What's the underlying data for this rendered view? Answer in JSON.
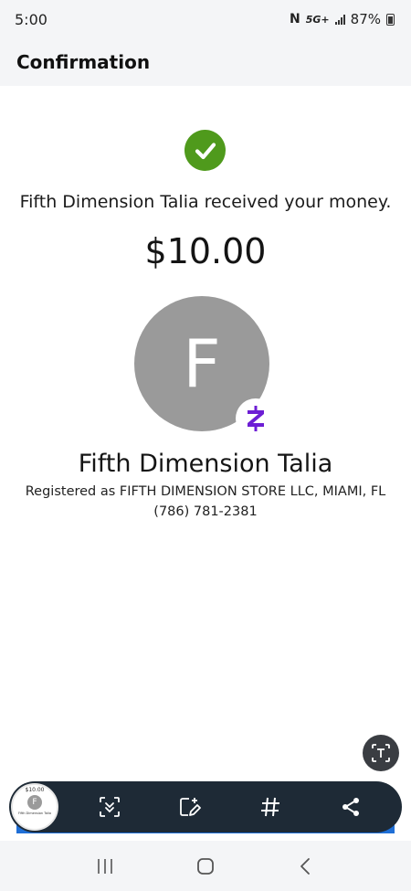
{
  "status_bar": {
    "time": "5:00",
    "nfc": "N",
    "network": "5G+",
    "battery": "87%"
  },
  "header": {
    "title": "Confirmation"
  },
  "confirmation": {
    "message": "Fifth Dimension Talia received your money.",
    "amount": "$10.00"
  },
  "recipient": {
    "initial": "F",
    "name": "Fifth Dimension Talia",
    "registered": "Registered as FIFTH DIMENSION STORE LLC, MIAMI, FL",
    "phone": "(786) 781-2381"
  },
  "screenshot_toolbar": {
    "thumbnail": {
      "amount": "$10.00",
      "initial": "F",
      "name": "Fifth Dimension Talia"
    },
    "tools": [
      "scroll-capture-icon",
      "draw-icon",
      "hashtag-icon",
      "share-icon"
    ]
  },
  "colors": {
    "success": "#4f9a1c",
    "zelle": "#6d1ed4",
    "avatar": "#9a9a9a",
    "toolbar": "#1e2a36",
    "accent_blue": "#1f6fd6"
  },
  "nav_bar": {
    "icons": [
      "recents-icon",
      "home-icon",
      "back-icon"
    ]
  }
}
